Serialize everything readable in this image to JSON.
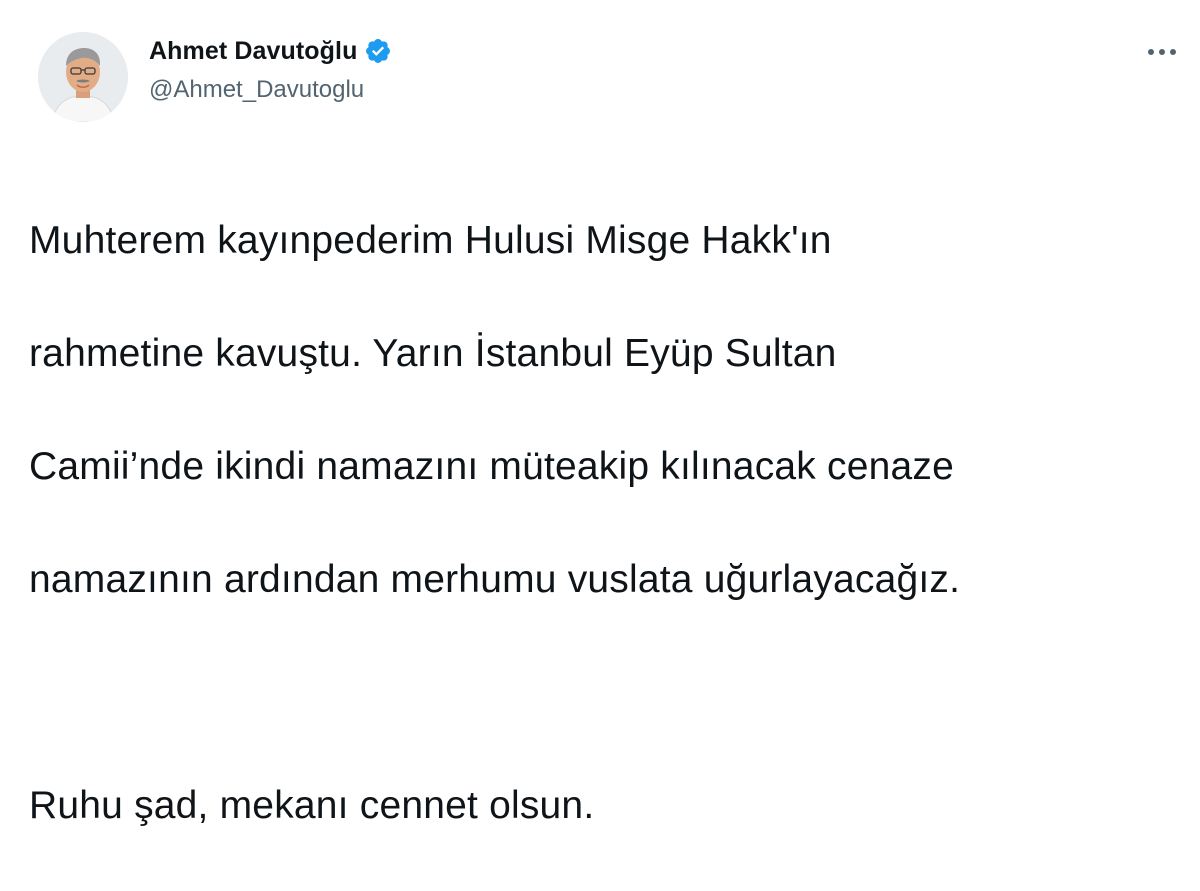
{
  "author": {
    "display_name": "Ahmet Davutoğlu",
    "handle": "@Ahmet_Davutoglu",
    "verified": true,
    "verified_color": "#1d9bf0"
  },
  "tweet": {
    "lines": [
      "Muhterem kayınpederim Hulusi Misge Hakk'ın",
      "rahmetine kavuştu. Yarın İstanbul Eyüp Sultan",
      "Camii’nde ikindi namazını müteakip kılınacak cenaze",
      "namazının ardından merhumu vuslata uğurlayacağız."
    ],
    "closing": "Ruhu şad, mekanı cennet olsun."
  },
  "icons": {
    "more": "more-horizontal-icon",
    "verified": "verified-badge-icon"
  }
}
